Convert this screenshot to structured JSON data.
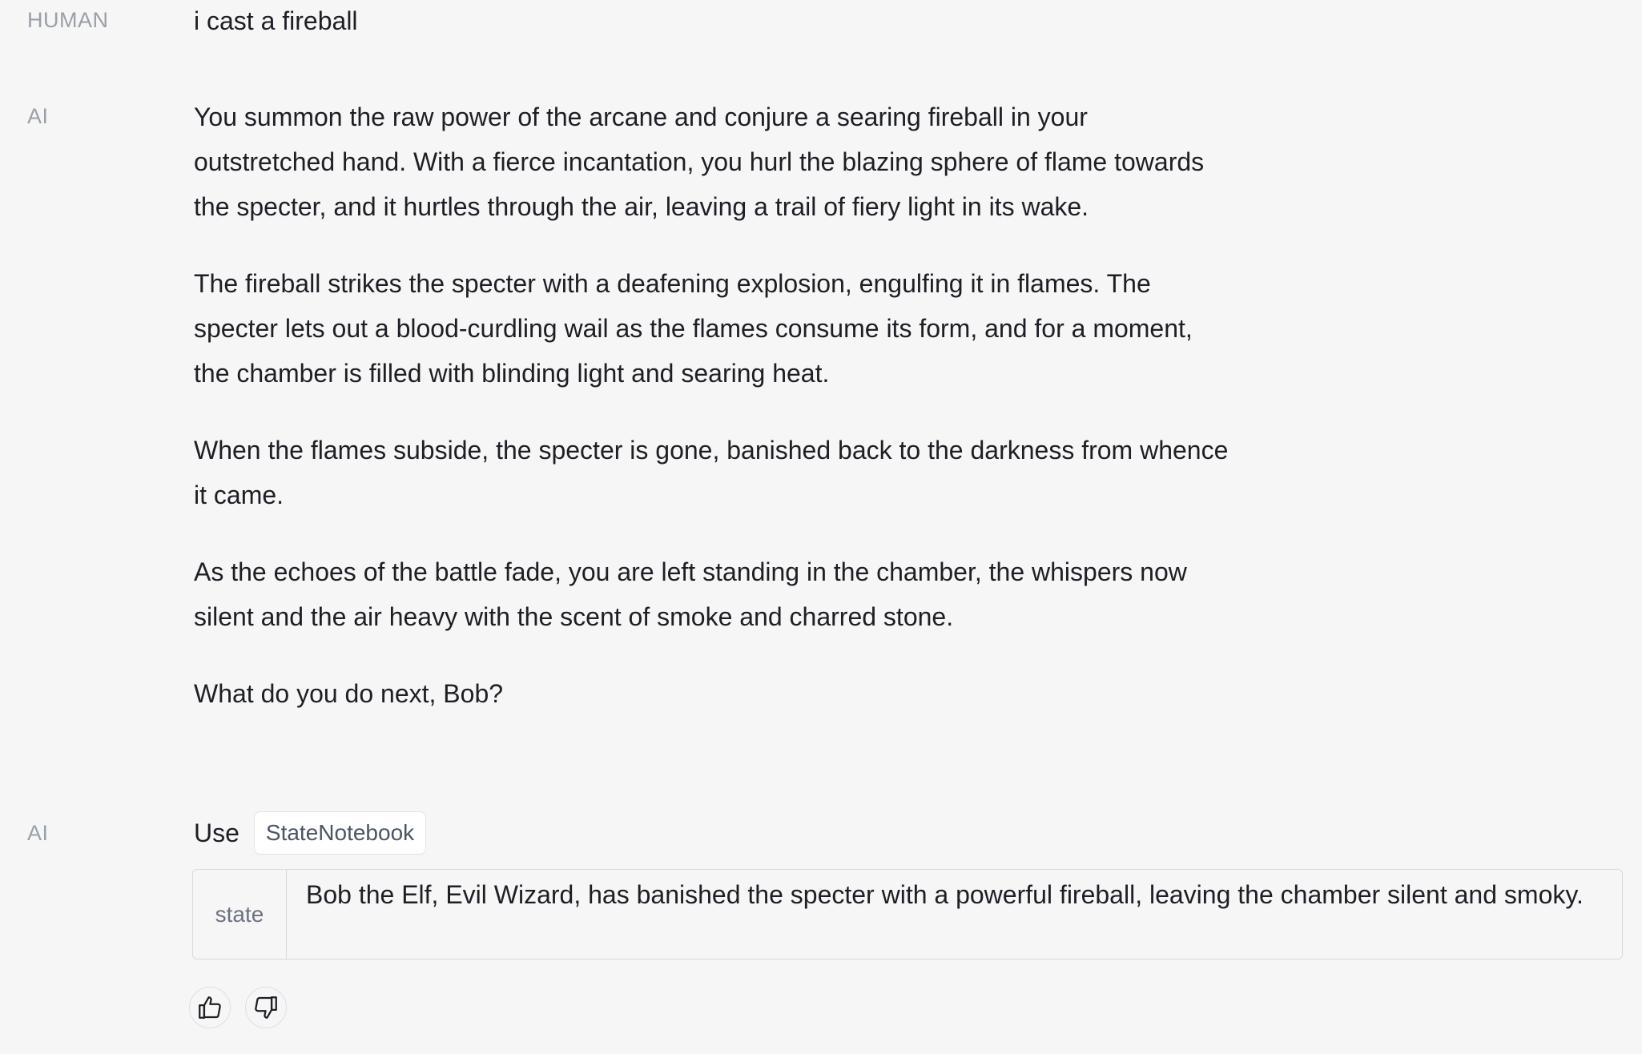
{
  "human": {
    "role_label": "HUMAN",
    "message": "i cast a fireball"
  },
  "ai_response": {
    "role_label": "AI",
    "paragraphs": [
      "You summon the raw power of the arcane and conjure a searing fireball in your outstretched hand. With a fierce incantation, you hurl the blazing sphere of flame towards the specter, and it hurtles through the air, leaving a trail of fiery light in its wake.",
      "The fireball strikes the specter with a deafening explosion, engulfing it in flames. The specter lets out a blood-curdling wail as the flames consume its form, and for a moment, the chamber is filled with blinding light and searing heat.",
      "When the flames subside, the specter is gone, banished back to the darkness from whence it came.",
      "As the echoes of the battle fade, you are left standing in the chamber, the whispers now silent and the air heavy with the scent of smoke and charred stone.",
      "What do you do next, Bob?"
    ]
  },
  "ai_tool_call": {
    "role_label": "AI",
    "use_label": "Use",
    "tool_name": "StateNotebook",
    "args": [
      {
        "key": "state",
        "value": "Bob the Elf, Evil Wizard, has banished the specter with a powerful fireball, leaving the chamber silent and smoky."
      }
    ]
  },
  "feedback": {
    "thumbs_up_icon": "thumbs-up-icon",
    "thumbs_down_icon": "thumbs-down-icon"
  }
}
